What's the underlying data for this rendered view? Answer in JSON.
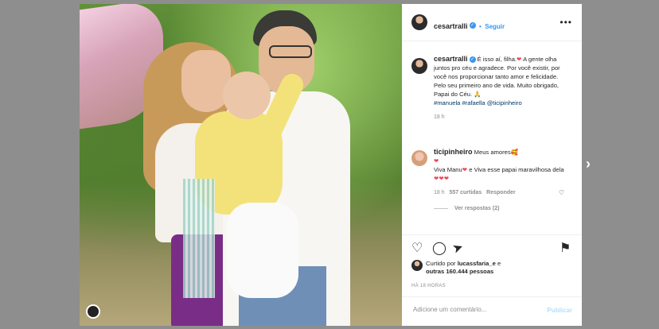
{
  "post": {
    "username": "cesartralli",
    "follow_label": "Seguir",
    "more_label": "•••",
    "caption_parts": {
      "a": "É isso aí, filha.",
      "b": " A gente olha juntos pro céu e agradece. Por você existir, por você nos proporcionar tanto amor e felicidade. Pelo seu primeiro ano de vida. Muito obrigado, Papai do Céu. 🙏",
      "hashtags": "#manuela #rafaella @ticipinheiro"
    },
    "caption_time": "18 h"
  },
  "comment": {
    "username": "ticipinheiro",
    "text_a": "Meus amores🥰",
    "text_b": "Viva Manu",
    "text_c": " e Viva esse papai maravilhosa dela ",
    "hearts_end": "❤❤❤",
    "time": "18 h",
    "likes": "557 curtidas",
    "reply": "Responder",
    "view_replies": "Ver respostas (2)"
  },
  "likes_line": {
    "prefix": "Curtido por ",
    "user": "lucassfaria_e",
    "mid": " e ",
    "count": "outras 160.444 pessoas"
  },
  "timestamp": "HÁ 18 HORAS",
  "add_comment": {
    "placeholder": "Adicione um comentário...",
    "post_label": "Publicar"
  },
  "icons": {
    "heart": "♡",
    "comment": "◯",
    "share": "➤",
    "bookmark": "⚑",
    "next": "›"
  },
  "colors": {
    "accent": "#3897f0",
    "heart": "#ed4956"
  }
}
